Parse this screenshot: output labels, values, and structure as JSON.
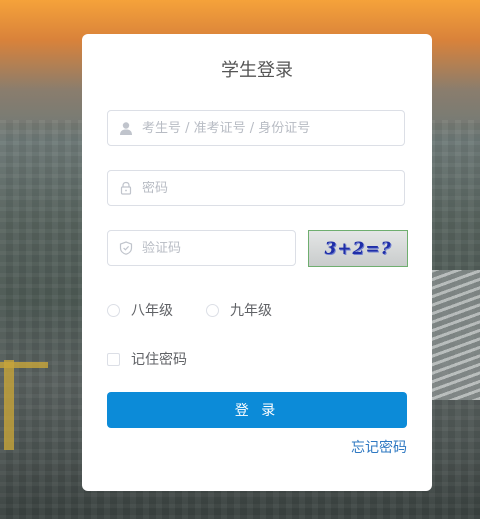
{
  "login": {
    "title": "学生登录",
    "username_placeholder": "考生号 / 准考证号 / 身份证号",
    "password_placeholder": "密码",
    "captcha_placeholder": "验证码",
    "captcha_text": "3+2=?",
    "grade_options": [
      "八年级",
      "九年级"
    ],
    "remember_label": "记住密码",
    "submit_label": "登 录",
    "forgot_label": "忘记密码"
  },
  "icons": {
    "username": "user-icon",
    "password": "lock-icon",
    "captcha": "shield-icon"
  },
  "colors": {
    "primary": "#0c8bd8",
    "link": "#2e78c2",
    "border": "#dcdfe6"
  }
}
